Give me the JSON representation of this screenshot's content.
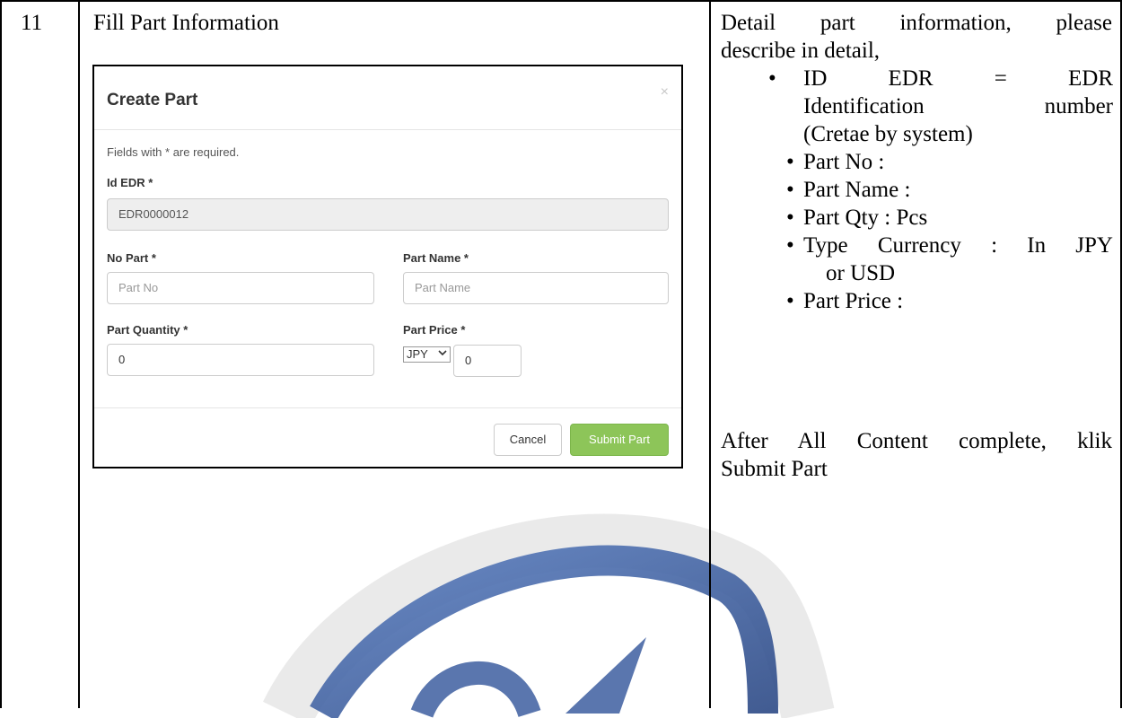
{
  "row": {
    "number": "11",
    "title": "Fill Part Information"
  },
  "dialog": {
    "title": "Create Part",
    "close_icon": "×",
    "required_note": "Fields with * are required.",
    "id_edr_label": "Id EDR *",
    "id_edr_value": "EDR0000012",
    "no_part_label": "No Part *",
    "no_part_placeholder": "Part No",
    "part_name_label": "Part Name *",
    "part_name_placeholder": "Part Name",
    "part_quantity_label": "Part Quantity *",
    "part_quantity_value": "0",
    "part_price_label": "Part Price *",
    "currency_selected": "JPY",
    "part_price_value": "0",
    "cancel_label": "Cancel",
    "submit_label": "Submit Part"
  },
  "description": {
    "intro_line1": "Detail part information, please",
    "intro_line2": "describe in detail,",
    "bullets": [
      {
        "lines": [
          "ID EDR = EDR",
          "Identification number",
          "(Cretae by system)"
        ]
      },
      {
        "text": "Part No :"
      },
      {
        "text": "Part Name :"
      },
      {
        "text": "Part Qty : Pcs"
      },
      {
        "lines": [
          "Type Currency : In JPY",
          "or USD"
        ]
      },
      {
        "text": "Part Price :"
      }
    ],
    "after_line1": "After All Content complete, klik",
    "after_line2": "Submit Part"
  },
  "colors": {
    "submit_button": "#8dc559",
    "watermark": "#3f5fa0"
  },
  "icons": {
    "close": "close-icon",
    "dropdown": "chevron-down-icon",
    "bullet": "bullet-dot-icon"
  }
}
